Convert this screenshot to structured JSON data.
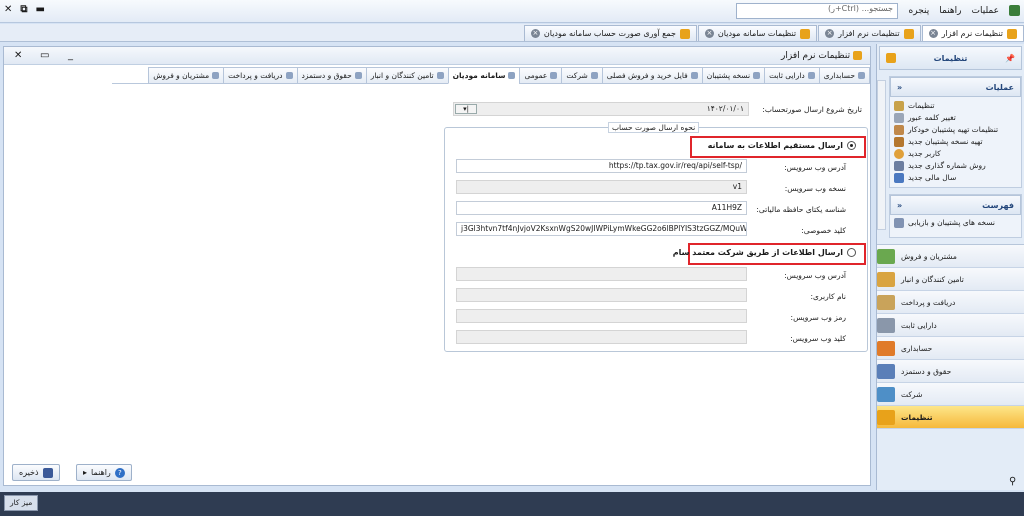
{
  "menu": {
    "operations": "عملیات",
    "help": "راهنما",
    "window": "پنجره"
  },
  "search": {
    "placeholder": "جستجو... (Ctrl+ر)"
  },
  "doc_tabs": [
    {
      "label": "تنظیمات نرم افزار",
      "active": true
    },
    {
      "label": "تنظیمات نرم افزار",
      "active": false
    },
    {
      "label": "تنظیمات سامانه مودیان",
      "active": false
    },
    {
      "label": "جمع آوری صورت حساب سامانه مودیان",
      "active": false
    }
  ],
  "panel": {
    "title": "تنظیمات نرم افزار"
  },
  "sub_tabs": [
    "حسابداری",
    "دارایی ثابت",
    "نسخه پشتیبان",
    "فایل خرید و فروش فصلی",
    "شرکت",
    "عمومی",
    "سامانه مودیان",
    "تامین کنندگان و انبار",
    "حقوق و دستمزد",
    "دریافت و پرداخت",
    "مشتریان و فروش"
  ],
  "active_sub_tab": "سامانه مودیان",
  "form": {
    "start_date_label": "تاریخ شروع ارسال صورتحساب:",
    "start_date_value": "۱۴۰۲/۰۱/۰۱",
    "group_title": "نحوه ارسال صورت حساب",
    "option_direct": "ارسال مستقیم اطلاعات به سامانه",
    "option_trusted": "ارسال اطلاعات از طریق شرکت معتمد سام",
    "direct_fields": [
      {
        "label": "آدرس وب سرویس:",
        "value": "https://tp.tax.gov.ir/req/api/self-tsp/",
        "gray": false
      },
      {
        "label": "نسخه وب سرویس:",
        "value": "v1",
        "gray": true
      },
      {
        "label": "شناسه یکتای حافظه مالیاتی:",
        "value": "A11H9Z",
        "gray": false
      },
      {
        "label": "کلید خصوصی:",
        "value": "j3Gl3htvn7tf4nJvjoV2KsxnWgS20wJIWPiLymWkeGG2o6lBPlYIS3tzGGZ/MQuWI",
        "gray": false
      }
    ],
    "trusted_fields": [
      {
        "label": "آدرس وب سرویس:",
        "value": ""
      },
      {
        "label": "نام کاربری:",
        "value": ""
      },
      {
        "label": "رمز وب سرویس:",
        "value": ""
      },
      {
        "label": "کلید وب سرویس:",
        "value": ""
      }
    ]
  },
  "buttons": {
    "help": "راهنما",
    "save": "ذخیره"
  },
  "sidebar": {
    "title": "تنظیمات",
    "operations_title": "عملیات",
    "operations": [
      "تنظیمات",
      "تغییر کلمه عبور",
      "تنظیمات تهیه پشتیبان خودکار",
      "تهیه نسخه پشتیبان جدید",
      "کاربر جدید",
      "روش شماره گذاری جدید",
      "سال مالی جدید"
    ],
    "list_title": "فهرست",
    "list_items": [
      "نسخه های پشتیبان و بازیابی"
    ],
    "nav": [
      "مشتریان و فروش",
      "تامین کنندگان و انبار",
      "دریافت و پرداخت",
      "دارایی ثابت",
      "حسابداری",
      "حقوق و دستمزد",
      "شرکت",
      "تنظیمات"
    ],
    "nav_active": "تنظیمات"
  },
  "statusbar": {
    "desktop": "میز کار"
  }
}
